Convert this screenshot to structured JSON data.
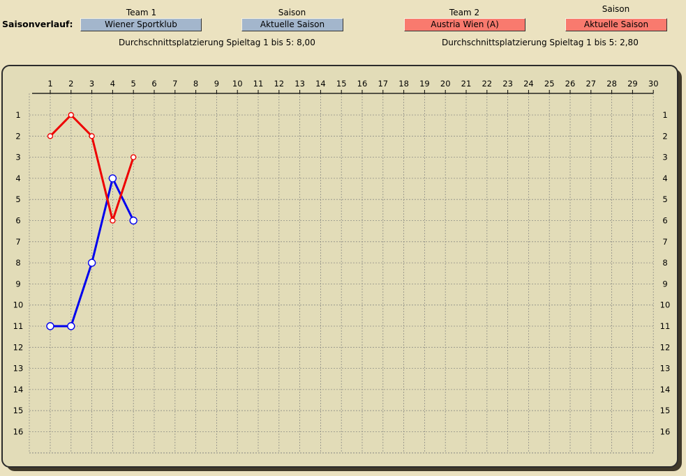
{
  "header": {
    "row_label": "Saisonverlauf:",
    "team1_caption": "Team 1",
    "team1_name": "Wiener Sportklub",
    "team1_season_caption": "Saison",
    "team1_season": "Aktuelle Saison",
    "team2_caption": "Team 2",
    "team2_name": "Austria Wien (A)",
    "team2_season_caption": "Saison",
    "team2_season": "Aktuelle Saison",
    "team1_avg": "Durchschnittsplatzierung Spieltag 1 bis 5:  8,00",
    "team2_avg": "Durchschnittsplatzierung Spieltag 1 bis 5:  2,80"
  },
  "colors": {
    "team1": "#0000ee",
    "team2": "#ee0000",
    "team1_box": "#a3b6cc",
    "team2_box": "#f97a6e"
  },
  "chart_data": {
    "type": "line",
    "title": "",
    "xlabel": "",
    "ylabel": "",
    "x_ticks": [
      1,
      2,
      3,
      4,
      5,
      6,
      7,
      8,
      9,
      10,
      11,
      12,
      13,
      14,
      15,
      16,
      17,
      18,
      19,
      20,
      21,
      22,
      23,
      24,
      25,
      26,
      27,
      28,
      29,
      30
    ],
    "y_ticks": [
      1,
      2,
      3,
      4,
      5,
      6,
      7,
      8,
      9,
      10,
      11,
      12,
      13,
      14,
      15,
      16
    ],
    "xlim": [
      1,
      30
    ],
    "ylim": [
      1,
      16
    ],
    "y_inverted": true,
    "grid": true,
    "series": [
      {
        "team": "team1",
        "x": [
          1,
          2,
          3,
          4,
          5
        ],
        "y": [
          11,
          11,
          8,
          4,
          6
        ]
      },
      {
        "team": "team2",
        "x": [
          1,
          2,
          3,
          4,
          5
        ],
        "y": [
          2,
          1,
          2,
          6,
          3
        ]
      }
    ]
  }
}
